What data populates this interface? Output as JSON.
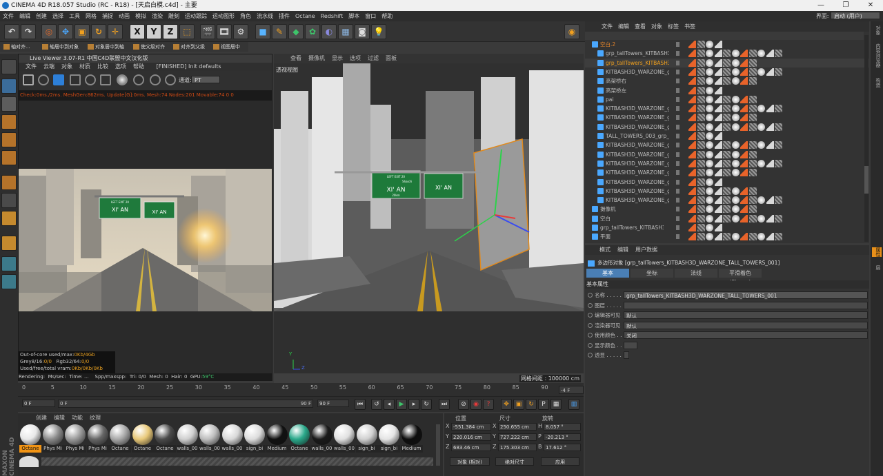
{
  "window": {
    "title": "CINEMA 4D R18.057 Studio (RC - R18) - [天启白模.c4d] - 主要",
    "controls": [
      "—",
      "❐",
      "✕"
    ]
  },
  "menubar": {
    "items": [
      "文件",
      "编辑",
      "创建",
      "选择",
      "工具",
      "网格",
      "捕捉",
      "动画",
      "模拟",
      "渲染",
      "雕刻",
      "运动跟踪",
      "运动图形",
      "角色",
      "流水线",
      "插件",
      "Octane",
      "Redshift",
      "脚本",
      "窗口",
      "帮助"
    ],
    "layout_label": "界面:",
    "layout_value": "启动 (用户)"
  },
  "toolbar": {
    "undo_icon": "undo-icon",
    "redo_icon": "redo-icon",
    "axis_x": "X",
    "axis_y": "Y",
    "axis_z": "Z"
  },
  "subtoolbar": [
    "轴对齐...",
    "轴居中到对象",
    "对象居中到轴",
    "使父级对齐",
    "对齐到父级",
    "视图居中"
  ],
  "live_viewer": {
    "title": "Live Viewer 3.07-R1 中国C4D联盟中文汉化版",
    "menu": [
      "文件",
      "云端",
      "对象",
      "材质",
      "比较",
      "选项",
      "帮助"
    ],
    "status": "[FINISHED] Init defaults",
    "channel_label": "通道:",
    "channel_value": "PT",
    "stats_line": "Check:0ms./2ms. MeshGen:862ms. Update[G]:0ms. Mesh:74 Nodes:201 Movable:74  0 0",
    "sign_title": "XI' AN",
    "sign_small": "LEFT EXIT 20",
    "ooc_label": "Out-of-core used/max:",
    "ooc_value": "0Kb/4Gb",
    "grey_label": "Grey8/16:",
    "grey_value": "0/0",
    "rgb_label": "Rgb32/64:",
    "rgb_value": "0/0",
    "vram_label": "Used/free/total vram:",
    "vram_value": "0Kb/0Kb/0Kb",
    "footer": [
      "Rendering:",
      "Ms/sec:",
      "Time: ...",
      "Spp/maxspp:",
      "Tri: 0/0",
      "Mesh: 0",
      "Hair: 0",
      "GPU:",
      "59°C"
    ]
  },
  "viewport": {
    "menu": [
      "查看",
      "摄像机",
      "显示",
      "选项",
      "过滤",
      "面板"
    ],
    "label": "透视视图",
    "grid_info": "网格间距 : 100000 cm",
    "sign_title": "XI' AN",
    "sign_small": "LEFT EXIT 20",
    "sign_city": "ShanXi",
    "sign_km": "20km",
    "axis_y": "Y",
    "axis_z": "Z"
  },
  "timeline": {
    "ticks": [
      "0",
      "5",
      "10",
      "15",
      "20",
      "25",
      "30",
      "35",
      "40",
      "45",
      "50",
      "55",
      "60",
      "65",
      "70",
      "75",
      "80",
      "85",
      "90"
    ],
    "end_field": "-4 F",
    "current": "0 F",
    "range_start": "0 F",
    "range_end": "90 F",
    "max": "90 F"
  },
  "materials": {
    "menu": [
      "创建",
      "编辑",
      "功能",
      "纹理"
    ],
    "items": [
      {
        "label": "Octane",
        "color": "#e8e8e8",
        "hl": true
      },
      {
        "label": "Phys Mi",
        "color": "#8a8a8a",
        "hl": false
      },
      {
        "label": "Phys Mi",
        "color": "#9a9a9a",
        "hl": false
      },
      {
        "label": "Phys Mi",
        "color": "#666666",
        "hl": false
      },
      {
        "label": "Octane",
        "color": "#a8a8a8",
        "hl": false
      },
      {
        "label": "Octane",
        "color": "#e8c878",
        "hl": false
      },
      {
        "label": "Octane",
        "color": "#4a4a4a",
        "hl": false
      },
      {
        "label": "walls_00",
        "color": "#cfcfcf",
        "hl": false
      },
      {
        "label": "walls_00",
        "color": "#bdbdbd",
        "hl": false
      },
      {
        "label": "walls_00",
        "color": "#d8d8d8",
        "hl": false
      },
      {
        "label": "sign_bi",
        "color": "#dcdcdc",
        "hl": false
      },
      {
        "label": "Medium",
        "color": "#111111",
        "hl": false
      },
      {
        "label": "Octane",
        "color": "#2aa88a",
        "hl": false
      },
      {
        "label": "walls_00",
        "color": "#1a1a1a",
        "hl": false
      },
      {
        "label": "walls_00",
        "color": "#e0e0e0",
        "hl": false
      },
      {
        "label": "sign_bi",
        "color": "#d0d0d0",
        "hl": false
      },
      {
        "label": "sign_bi",
        "color": "#e4e4e4",
        "hl": false
      },
      {
        "label": "Medium",
        "color": "#0e0e0e",
        "hl": false
      }
    ]
  },
  "coords": {
    "headers": [
      "位置",
      "尺寸",
      "旋转"
    ],
    "rows": [
      {
        "axis": "X",
        "pos": "-551.384 cm",
        "size_axis": "X",
        "size": "250.655 cm",
        "rot_axis": "H",
        "rot": "8.057 °"
      },
      {
        "axis": "Y",
        "pos": "220.016 cm",
        "size_axis": "Y",
        "size": "727.222 cm",
        "rot_axis": "P",
        "rot": "-20.213 °"
      },
      {
        "axis": "Z",
        "pos": "683.46 cm",
        "size_axis": "Z",
        "size": "175.303 cm",
        "rot_axis": "B",
        "rot": "17.612 °"
      }
    ],
    "mode1": "对象 (相对)",
    "mode2": "绝对尺寸",
    "apply": "应用"
  },
  "object_manager": {
    "menu": [
      "文件",
      "编辑",
      "查看",
      "对象",
      "标签",
      "书签"
    ],
    "rows": [
      {
        "name": "空白.2",
        "color": "#e0832b",
        "indent": 0
      },
      {
        "name": "grp_tallTowers_KITBASH3I",
        "color": "#bdbdbd",
        "indent": 1
      },
      {
        "name": "grp_tallTowers_KITBASH3I",
        "color": "#f2a11d",
        "indent": 1
      },
      {
        "name": "KITBASH3D_WARZONE_gi",
        "color": "#bdbdbd",
        "indent": 1
      },
      {
        "name": "高架桥右",
        "color": "#bdbdbd",
        "indent": 1
      },
      {
        "name": "高架桥左",
        "color": "#bdbdbd",
        "indent": 1
      },
      {
        "name": "pai",
        "color": "#bdbdbd",
        "indent": 1
      },
      {
        "name": "KITBASH3D_WARZONE_gi",
        "color": "#bdbdbd",
        "indent": 1
      },
      {
        "name": "KITBASH3D_WARZONE_gi",
        "color": "#bdbdbd",
        "indent": 1
      },
      {
        "name": "KITBASH3D_WARZONE_gi",
        "color": "#bdbdbd",
        "indent": 1
      },
      {
        "name": "TALL_TOWERS_003_grp_ta",
        "color": "#bdbdbd",
        "indent": 1
      },
      {
        "name": "KITBASH3D_WARZONE_gi",
        "color": "#bdbdbd",
        "indent": 1
      },
      {
        "name": "KITBASH3D_WARZONE_gi",
        "color": "#bdbdbd",
        "indent": 1
      },
      {
        "name": "KITBASH3D_WARZONE_gi",
        "color": "#bdbdbd",
        "indent": 1
      },
      {
        "name": "KITBASH3D_WARZONE_gi",
        "color": "#bdbdbd",
        "indent": 1
      },
      {
        "name": "KITBASH3D_WARZONE_gi",
        "color": "#bdbdbd",
        "indent": 1
      },
      {
        "name": "KITBASH3D_WARZONE_gi",
        "color": "#bdbdbd",
        "indent": 1
      },
      {
        "name": "KITBASH3D_WARZONE_gi",
        "color": "#bdbdbd",
        "indent": 1
      },
      {
        "name": "摄像机",
        "color": "#bdbdbd",
        "indent": 0
      },
      {
        "name": "空白",
        "color": "#bdbdbd",
        "indent": 0
      },
      {
        "name": "grp_tallTowers_KITBASH3D_",
        "color": "#bdbdbd",
        "indent": 0
      },
      {
        "name": "平面",
        "color": "#bdbdbd",
        "indent": 0
      }
    ]
  },
  "attributes": {
    "menu": [
      "模式",
      "编辑",
      "用户数据"
    ],
    "object_title": "多边形对象 [grp_tallTowers_KITBASH3D_WARZONE_TALL_TOWERS_001]",
    "tabs": [
      "基本",
      "坐标",
      "法线",
      "平滑着色(Phong)"
    ],
    "section": "基本属性",
    "fields": [
      {
        "label": "名称 . . . . . . .",
        "value": "grp_tallTowers_KITBASH3D_WARZONE_TALL_TOWERS_001"
      },
      {
        "label": "图层 . . . . . . .",
        "value": ""
      },
      {
        "label": "编辑器可见",
        "value": "默认"
      },
      {
        "label": "渲染器可见",
        "value": "默认"
      },
      {
        "label": "使用颜色 . . .",
        "value": "关闭"
      },
      {
        "label": "显示颜色 . . .",
        "value": ""
      },
      {
        "label": "透显 . . . . . . .",
        "value": ""
      }
    ]
  },
  "right_strip": [
    "对象",
    "内容浏览器",
    "构造",
    "属性",
    "层"
  ]
}
